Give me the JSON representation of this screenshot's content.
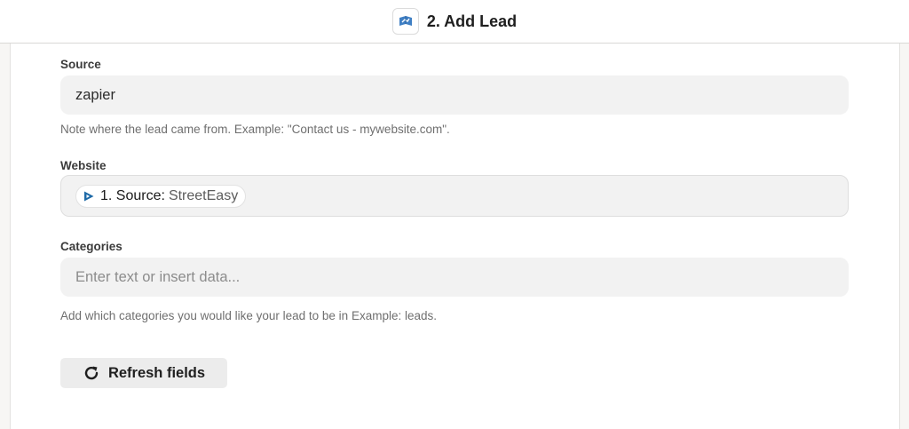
{
  "header": {
    "step_title": "2. Add Lead",
    "app_icon": "real-estate-crm-app-icon"
  },
  "fields": {
    "source": {
      "label": "Source",
      "value": "zapier",
      "help": "Note where the lead came from. Example: \"Contact us - mywebsite.com\"."
    },
    "website": {
      "label": "Website",
      "pill": {
        "icon": "streeteasy-app-icon",
        "step": "1. Source:",
        "value": "StreetEasy"
      }
    },
    "categories": {
      "label": "Categories",
      "placeholder": "Enter text or insert data...",
      "help": "Add which categories you would like your lead to be in Example: leads."
    }
  },
  "actions": {
    "refresh_label": "Refresh fields",
    "refresh_icon": "refresh-icon"
  },
  "colors": {
    "background": "#f7f6f4",
    "panel": "#ffffff",
    "field_bg": "#f2f2f2",
    "button_bg": "#ececec",
    "streeteasy_blue": "#1e6aa7"
  }
}
